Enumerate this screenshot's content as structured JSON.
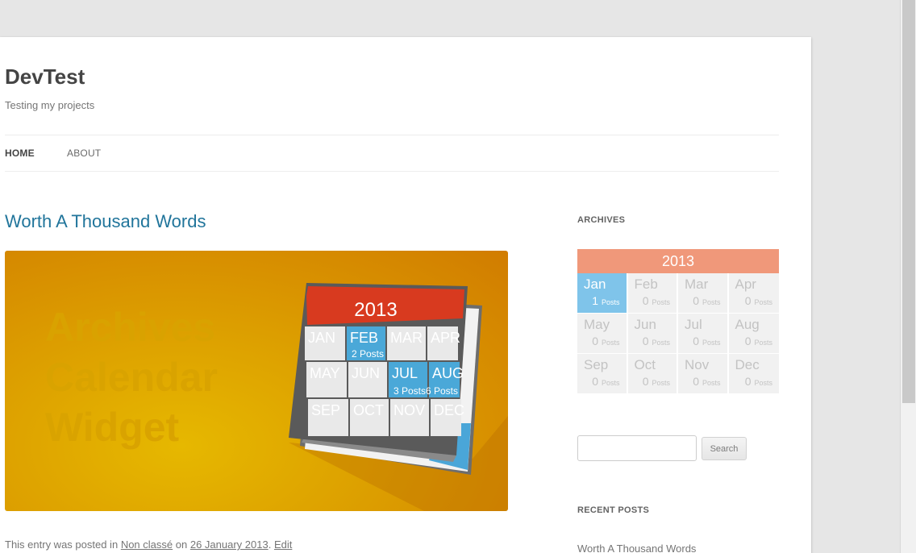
{
  "site": {
    "title": "DevTest",
    "description": "Testing my projects"
  },
  "nav": {
    "items": [
      {
        "label": "HOME"
      },
      {
        "label": "ABOUT"
      }
    ]
  },
  "post": {
    "title": "Worth A Thousand Words",
    "image": {
      "watermark": [
        "Archives",
        "Calendar",
        "Widget"
      ],
      "calendar": {
        "year": "2013",
        "months": [
          {
            "m": "JAN",
            "posts": ""
          },
          {
            "m": "FEB",
            "posts": "2 Posts"
          },
          {
            "m": "MAR",
            "posts": ""
          },
          {
            "m": "APR",
            "posts": ""
          },
          {
            "m": "MAY",
            "posts": ""
          },
          {
            "m": "JUN",
            "posts": ""
          },
          {
            "m": "JUL",
            "posts": "3 Posts"
          },
          {
            "m": "AUG",
            "posts": "6 Posts"
          },
          {
            "m": "SEP",
            "posts": ""
          },
          {
            "m": "OCT",
            "posts": ""
          },
          {
            "m": "NOV",
            "posts": ""
          },
          {
            "m": "DEC",
            "posts": ""
          }
        ]
      }
    },
    "meta": {
      "prefix": "This entry was posted in",
      "category": "Non classé",
      "on": "on",
      "date": "26 January 2013",
      "dot": ".",
      "edit": "Edit"
    }
  },
  "sidebar": {
    "archives": {
      "title": "ARCHIVES",
      "year": "2013",
      "months": [
        {
          "name": "Jan",
          "count": "1",
          "label": "Posts"
        },
        {
          "name": "Feb",
          "count": "0",
          "label": "Posts"
        },
        {
          "name": "Mar",
          "count": "0",
          "label": "Posts"
        },
        {
          "name": "Apr",
          "count": "0",
          "label": "Posts"
        },
        {
          "name": "May",
          "count": "0",
          "label": "Posts"
        },
        {
          "name": "Jun",
          "count": "0",
          "label": "Posts"
        },
        {
          "name": "Jul",
          "count": "0",
          "label": "Posts"
        },
        {
          "name": "Aug",
          "count": "0",
          "label": "Posts"
        },
        {
          "name": "Sep",
          "count": "0",
          "label": "Posts"
        },
        {
          "name": "Oct",
          "count": "0",
          "label": "Posts"
        },
        {
          "name": "Nov",
          "count": "0",
          "label": "Posts"
        },
        {
          "name": "Dec",
          "count": "0",
          "label": "Posts"
        }
      ]
    },
    "search": {
      "placeholder": "",
      "button": "Search"
    },
    "recent": {
      "title": "RECENT POSTS",
      "items": [
        "Worth A Thousand Words"
      ]
    }
  },
  "colors": {
    "link": "#21759b",
    "archive_header": "#f0987a",
    "archive_active": "#7fc4ea"
  }
}
